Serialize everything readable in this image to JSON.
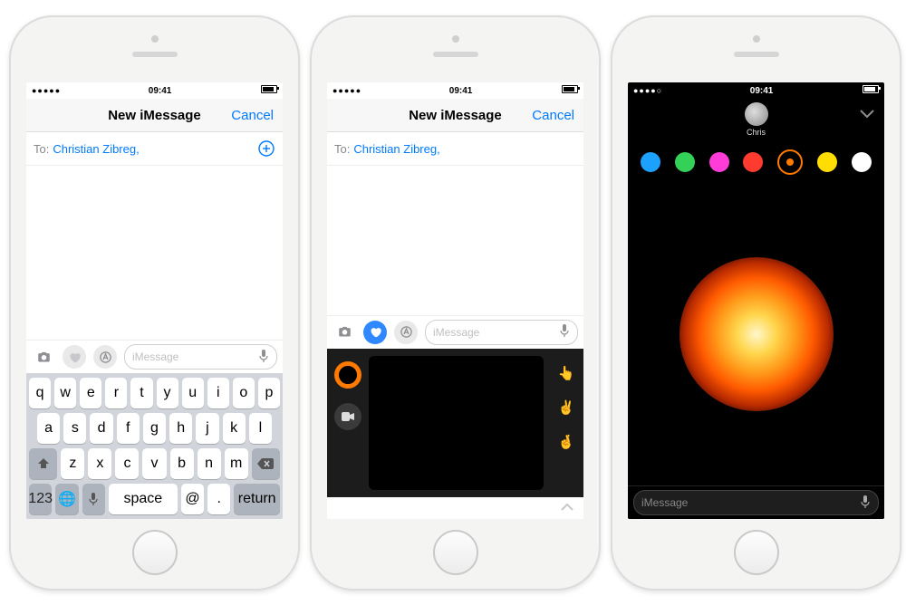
{
  "status": {
    "time": "09:41"
  },
  "nav": {
    "title": "New iMessage",
    "cancel": "Cancel"
  },
  "to": {
    "label": "To:",
    "recipient": "Christian Zibreg,"
  },
  "compose": {
    "placeholder": "iMessage"
  },
  "keyboard": {
    "r1": [
      "q",
      "w",
      "e",
      "r",
      "t",
      "y",
      "u",
      "i",
      "o",
      "p"
    ],
    "r2": [
      "a",
      "s",
      "d",
      "f",
      "g",
      "h",
      "j",
      "k",
      "l"
    ],
    "r3": [
      "z",
      "x",
      "c",
      "v",
      "b",
      "n",
      "m"
    ],
    "bottom": {
      "num": "123",
      "space": "space",
      "at": "@",
      "dot": ".",
      "ret": "return"
    }
  },
  "contact": {
    "name": "Chris"
  },
  "colors": [
    "#1da1ff",
    "#34d158",
    "#ff3cd8",
    "#ff3b30",
    "selected-orange",
    "#ffdd00",
    "#ffffff"
  ]
}
